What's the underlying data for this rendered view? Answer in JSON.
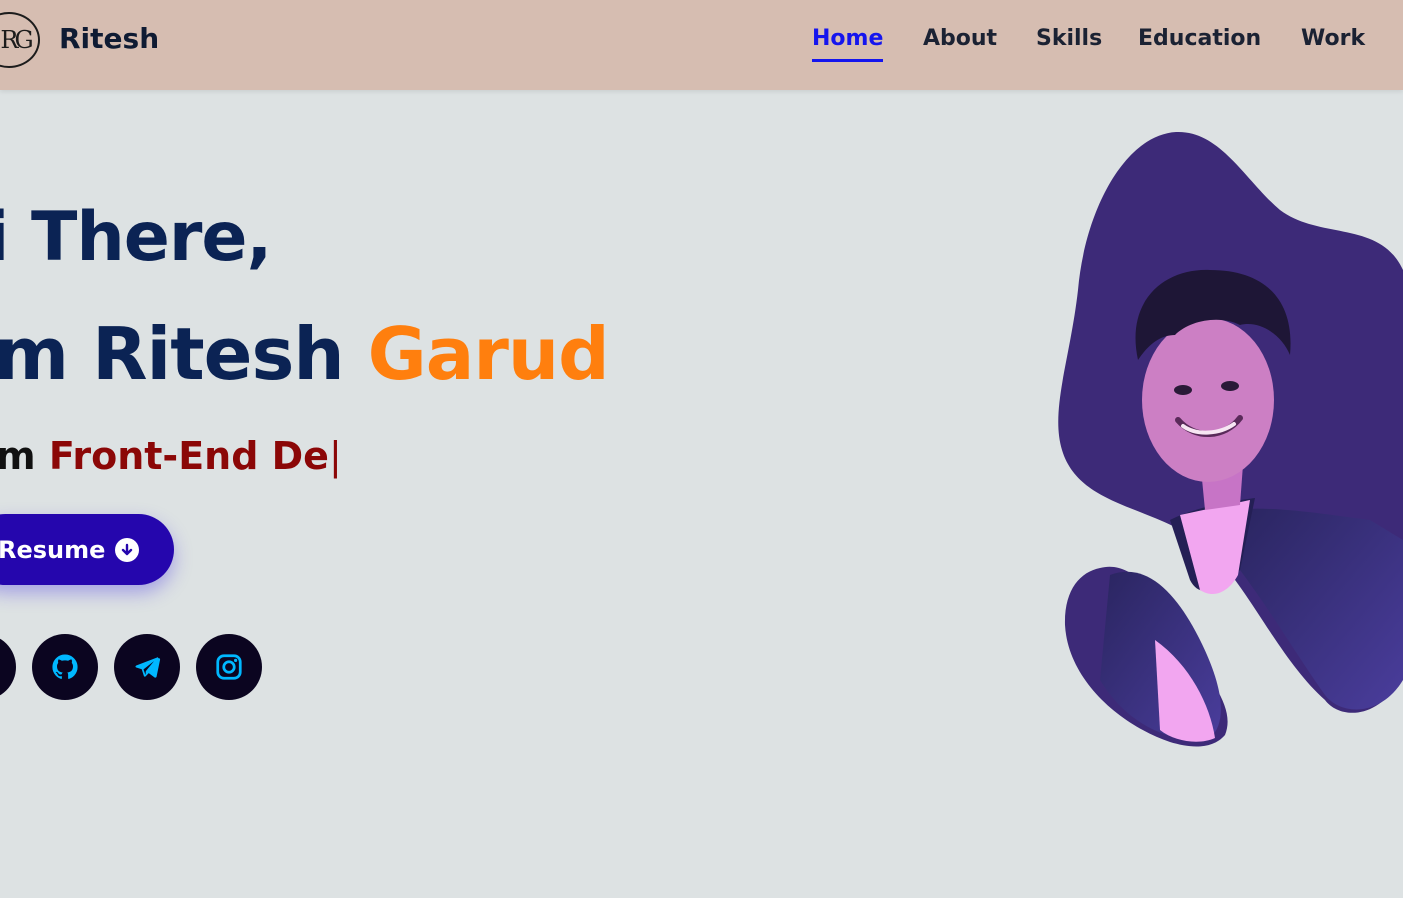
{
  "header": {
    "logo_text": "RG",
    "brand": "Ritesh",
    "nav": [
      {
        "label": "Home",
        "active": true
      },
      {
        "label": "About",
        "active": false
      },
      {
        "label": "Skills",
        "active": false
      },
      {
        "label": "Education",
        "active": false
      },
      {
        "label": "Work",
        "active": false
      }
    ]
  },
  "hero": {
    "greeting": "i There,",
    "name_prefix": "m Ritesh ",
    "name_accent": "Garud",
    "typed_prefix": "m ",
    "typed_role": "Front-End De",
    "typed_cursor": "|",
    "resume_label": "Resume",
    "resume_icon": "download-circle-icon"
  },
  "social": [
    {
      "name": "linkedin-icon"
    },
    {
      "name": "github-icon"
    },
    {
      "name": "telegram-icon"
    },
    {
      "name": "instagram-icon"
    }
  ],
  "colors": {
    "header_bg": "#d6bdb1",
    "page_bg": "#dde2e3",
    "nav_active": "#1515ee",
    "heading": "#0b2354",
    "accent_orange": "#ff7f0e",
    "role_red": "#8b0707",
    "button": "#2506ad",
    "blob": "#3d2a78"
  }
}
